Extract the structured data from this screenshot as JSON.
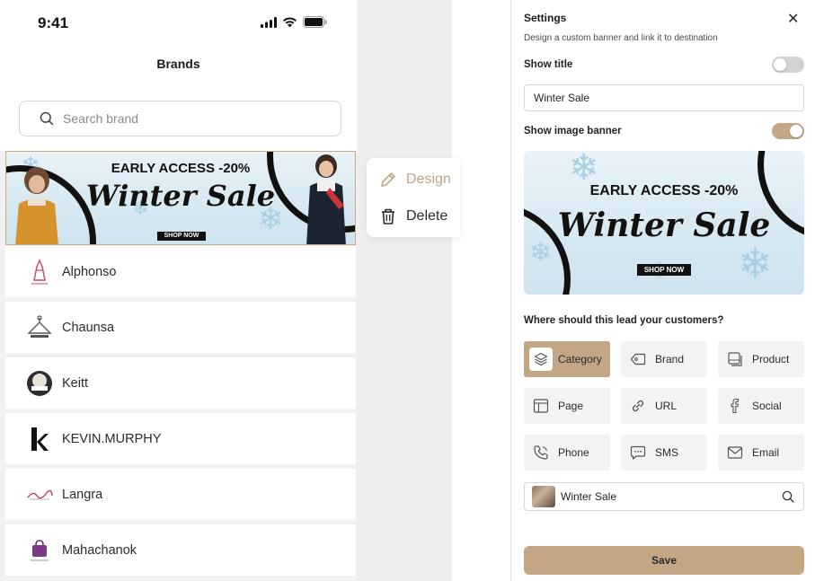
{
  "phone": {
    "time": "9:41",
    "title": "Brands",
    "search_placeholder": "Search brand",
    "banner": {
      "line1": "EARLY ACCESS -20%",
      "line2": "Winter Sale",
      "cta": "SHOP NOW"
    },
    "brands": [
      {
        "name": "Alphonso",
        "icon": "dress-logo"
      },
      {
        "name": "Chaunsa",
        "icon": "hanger-logo"
      },
      {
        "name": "Keitt",
        "icon": "keitt-round-logo"
      },
      {
        "name": "KEVIN.MURPHY",
        "icon": "k-letter-logo"
      },
      {
        "name": "Langra",
        "icon": "langra-script-logo"
      },
      {
        "name": "Mahachanok",
        "icon": "bag-logo"
      }
    ]
  },
  "context_menu": {
    "design_label": "Design",
    "delete_label": "Delete"
  },
  "settings": {
    "title": "Settings",
    "close_glyph": "✕",
    "subtitle": "Design a custom banner and link it to destination",
    "show_title_label": "Show title",
    "show_title_enabled": false,
    "title_value": "Winter Sale",
    "show_image_label": "Show image banner",
    "show_image_enabled": true,
    "banner": {
      "line1": "EARLY ACCESS -20%",
      "line2": "Winter Sale",
      "cta": "SHOP NOW"
    },
    "question": "Where should this lead your customers?",
    "options": [
      {
        "label": "Category",
        "icon": "layers-icon",
        "selected": true
      },
      {
        "label": "Brand",
        "icon": "tag-icon",
        "selected": false
      },
      {
        "label": "Product",
        "icon": "product-icon",
        "selected": false
      },
      {
        "label": "Page",
        "icon": "page-icon",
        "selected": false
      },
      {
        "label": "URL",
        "icon": "link-icon",
        "selected": false
      },
      {
        "label": "Social",
        "icon": "facebook-icon",
        "selected": false
      },
      {
        "label": "Phone",
        "icon": "phone-icon",
        "selected": false
      },
      {
        "label": "SMS",
        "icon": "message-icon",
        "selected": false
      },
      {
        "label": "Email",
        "icon": "mail-icon",
        "selected": false
      }
    ],
    "destination_value": "Winter Sale",
    "save_label": "Save"
  },
  "colors": {
    "accent": "#c3a784",
    "accent_text": "#c4a582",
    "toggle_off": "#d3d3d6",
    "option_bg": "#f3f3f5"
  }
}
